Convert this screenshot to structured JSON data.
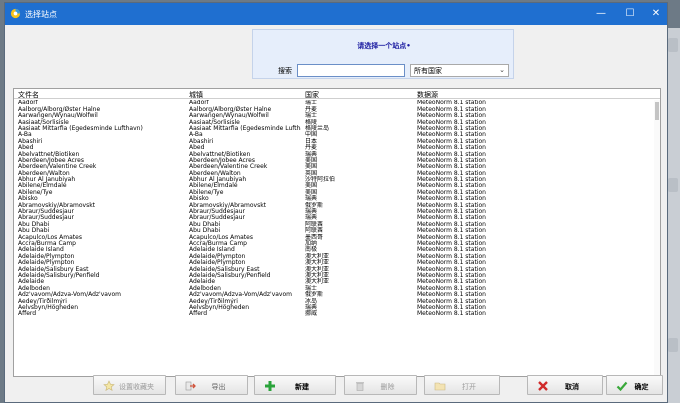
{
  "window": {
    "title": "选择站点",
    "controls": {
      "minimize": "—",
      "maximize": "☐",
      "close": "✕"
    }
  },
  "header": {
    "prompt": "请选择一个站点•"
  },
  "search": {
    "label": "搜索",
    "value": "",
    "placeholder": "",
    "country_selected": "所有国家"
  },
  "table": {
    "columns": [
      "文件名",
      "城镇",
      "国家",
      "数据源"
    ],
    "rows": [
      [
        "Aadorf",
        "Aadorf",
        "瑞士",
        "MeteoNorm 8.1 station"
      ],
      [
        "Aalborg/Alborg/Øster Halne",
        "Aalborg/Alborg/Øster Halne",
        "丹麦",
        "MeteoNorm 8.1 station"
      ],
      [
        "Aarwangen/Wynau/Wolfwil",
        "Aarwangen/Wynau/Wolfwil",
        "瑞士",
        "MeteoNorm 8.1 station"
      ],
      [
        "Aasiaat/Sorlisisle",
        "Aasiaat/Sorlisisle",
        "格陵",
        "MeteoNorm 8.1 station"
      ],
      [
        "Aasiaat Mittarfia (Egedesminde Lufthavn)",
        "Aasiaat Mittarfia (Egedesminde Lufthavn)",
        "格陵兰岛",
        "MeteoNorm 8.1 station"
      ],
      [
        "A-Ba",
        "A-Ba",
        "中国",
        "MeteoNorm 8.1 station"
      ],
      [
        "Abashiri",
        "Abashiri",
        "日本",
        "MeteoNorm 8.1 station"
      ],
      [
        "Abed",
        "Abed",
        "丹麦",
        "MeteoNorm 8.1 station"
      ],
      [
        "Abelvattnet/Biotiken",
        "Abelvattnet/Biotiken",
        "瑞典",
        "MeteoNorm 8.1 station"
      ],
      [
        "Aberdeen/Jobee Acres",
        "Aberdeen/Jobee Acres",
        "美国",
        "MeteoNorm 8.1 station"
      ],
      [
        "Aberdeen/Valentine Creek",
        "Aberdeen/Valentine Creek",
        "美国",
        "MeteoNorm 8.1 station"
      ],
      [
        "Aberdeen/Walton",
        "Aberdeen/Walton",
        "英国",
        "MeteoNorm 8.1 station"
      ],
      [
        "Abhur Al Janubiyah",
        "Abhur Al Janubiyah",
        "沙特阿拉伯",
        "MeteoNorm 8.1 station"
      ],
      [
        "Abilene/Elmdale",
        "Abilene/Elmdale",
        "美国",
        "MeteoNorm 8.1 station"
      ],
      [
        "Abilene/Tye",
        "Abilene/Tye",
        "美国",
        "MeteoNorm 8.1 station"
      ],
      [
        "Abisko",
        "Abisko",
        "瑞典",
        "MeteoNorm 8.1 station"
      ],
      [
        "Abramovskiy/Abramovskt",
        "Abramovskiy/Abramovskt",
        "俄罗斯",
        "MeteoNorm 8.1 station"
      ],
      [
        "Abraur/Suddesjaur",
        "Abraur/Suddesjaur",
        "瑞典",
        "MeteoNorm 8.1 station"
      ],
      [
        "Abraur/Suddesjaur",
        "Abraur/Suddesjaur",
        "瑞典",
        "MeteoNorm 8.1 station"
      ],
      [
        "Abu Dhabi",
        "Abu Dhabi",
        "阿联酋",
        "MeteoNorm 8.1 station"
      ],
      [
        "Abu Dhabi",
        "Abu Dhabi",
        "阿联酋",
        "MeteoNorm 8.1 station"
      ],
      [
        "Acapulco/Los Amates",
        "Acapulco/Los Amates",
        "墨西哥",
        "MeteoNorm 8.1 station"
      ],
      [
        "Accra/Burma Camp",
        "Accra/Burma Camp",
        "加纳",
        "MeteoNorm 8.1 station"
      ],
      [
        "Adelaide Island",
        "Adelaide Island",
        "南极",
        "MeteoNorm 8.1 station"
      ],
      [
        "Adelaide/Plympton",
        "Adelaide/Plympton",
        "澳大利亚",
        "MeteoNorm 8.1 station"
      ],
      [
        "Adelaide/Plympton",
        "Adelaide/Plympton",
        "澳大利亚",
        "MeteoNorm 8.1 station"
      ],
      [
        "Adelaide/Salisbury East",
        "Adelaide/Salisbury East",
        "澳大利亚",
        "MeteoNorm 8.1 station"
      ],
      [
        "Adelaide/Salisbury/Penfield",
        "Adelaide/Salisbury/Penfield",
        "澳大利亚",
        "MeteoNorm 8.1 station"
      ],
      [
        "Adelaide",
        "Adelaide",
        "澳大利亚",
        "MeteoNorm 8.1 station"
      ],
      [
        "Adelboden",
        "Adelboden",
        "瑞士",
        "MeteoNorm 8.1 station"
      ],
      [
        "Adz'vavom/Adzva-Vom/Adz'vavom",
        "Adz'vavom/Adzva-Vom/Adz'vavom",
        "俄罗斯",
        "MeteoNorm 8.1 station"
      ],
      [
        "Aedey/Tirðilmýri",
        "Aedey/Tirðilmýri",
        "冰岛",
        "MeteoNorm 8.1 station"
      ],
      [
        "Aelvsbyn/Högheden",
        "Aelvsbyn/Högheden",
        "瑞典",
        "MeteoNorm 8.1 station"
      ],
      [
        "Äfferd",
        "Äfferd",
        "挪威",
        "MeteoNorm 8.1 station"
      ]
    ]
  },
  "buttons": {
    "set_favorite": "设置收藏夹",
    "export": "导出",
    "new": "新建",
    "delete": "删除",
    "open": "打开",
    "cancel": "取消",
    "ok": "确定"
  },
  "colors": {
    "titlebar": "#1f6fd0",
    "prompt_text": "#1a1aa0",
    "header_panel": "#e6eefb"
  },
  "icons": {
    "app": "app-sun-icon",
    "favorite": "star-icon",
    "export": "export-arrow-icon",
    "new": "plus-icon",
    "delete": "trash-icon",
    "open": "folder-icon",
    "cancel": "x-icon",
    "ok": "checkmark-icon"
  }
}
